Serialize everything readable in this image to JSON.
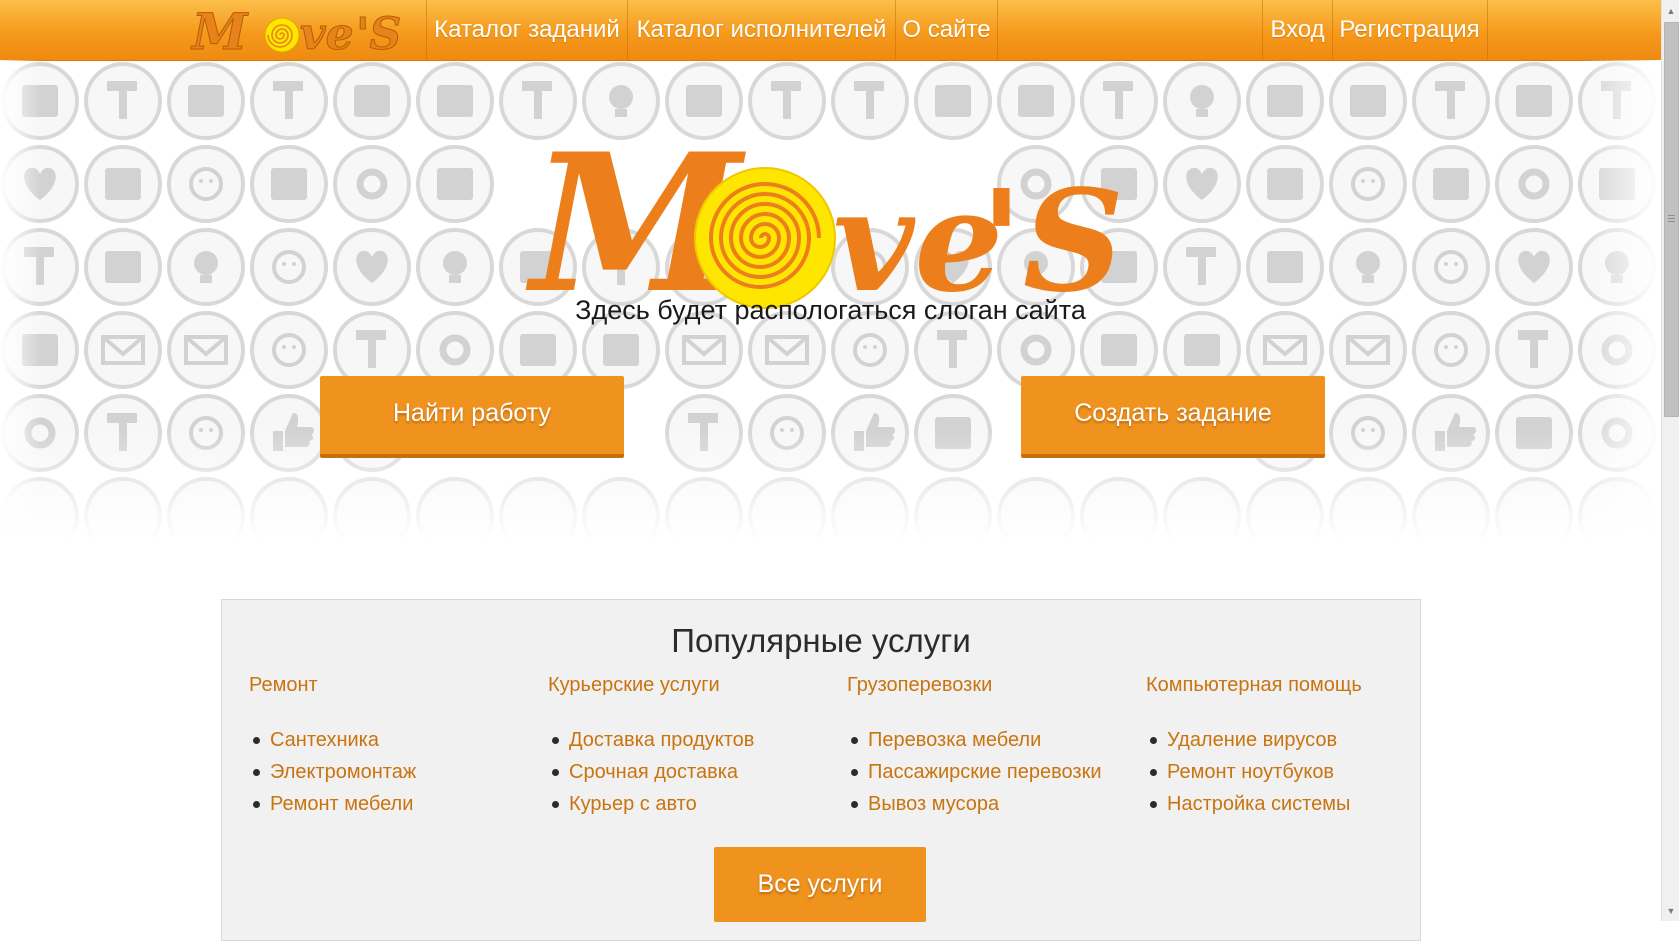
{
  "brand": {
    "logo_text_a": "M",
    "logo_text_b": "ve",
    "logo_text_c": "'S",
    "orange": "#f0921e",
    "link_color": "#c9740f",
    "nav_gradient": [
      "#fbbf4a",
      "#ef8a10"
    ]
  },
  "nav": {
    "logo_icon": "moves-logo-icon",
    "left_links": [
      {
        "label": "Каталог заданий"
      },
      {
        "label": "Каталог исполнителей"
      },
      {
        "label": "О сайте"
      }
    ],
    "login_label": "Вход",
    "register_label": "Регистрация"
  },
  "hero": {
    "pattern_icons": [
      "guitar-icon",
      "handshake-icon",
      "drill-icon",
      "hammer-icon",
      "money-icon",
      "books-icon",
      "brush-icon",
      "calendar-icon",
      "support-icon",
      "projector-icon",
      "wrench-icon",
      "laptop-icon",
      "scissors-icon",
      "pencil-icon",
      "balloons-icon",
      "heart-icon",
      "bulb-icon",
      "abc-blocks-icon",
      "truck-icon",
      "mail-icon",
      "email-icon",
      "network-icon",
      "tools-icon",
      "palette-icon",
      "car-icon",
      "paint-roller-icon",
      "duck-icon",
      "thumbs-up-icon",
      "growth-chart-icon"
    ],
    "slogan": "Здесь будет распологаться слоган сайта",
    "find_work_label": "Найти работу",
    "create_task_label": "Создать задание"
  },
  "services": {
    "title": "Популярные услуги",
    "columns": [
      {
        "category": "Ремонт",
        "items": [
          "Сантехника",
          "Электромонтаж",
          "Ремонт мебели"
        ]
      },
      {
        "category": "Курьерские услуги",
        "items": [
          "Доставка продуктов",
          "Срочная доставка",
          "Курьер с авто"
        ]
      },
      {
        "category": "Грузоперевозки",
        "items": [
          "Перевозка мебели",
          "Пассажирские перевозки",
          "Вывоз мусора"
        ]
      },
      {
        "category": "Компьютерная помощь",
        "items": [
          "Удаление вирусов",
          "Ремонт ноутбуков",
          "Настройка системы"
        ]
      }
    ],
    "all_services_label": "Все услуги"
  },
  "scrollbar": {
    "up_icon": "scroll-up-arrow-icon",
    "down_icon": "scroll-down-arrow-icon"
  }
}
